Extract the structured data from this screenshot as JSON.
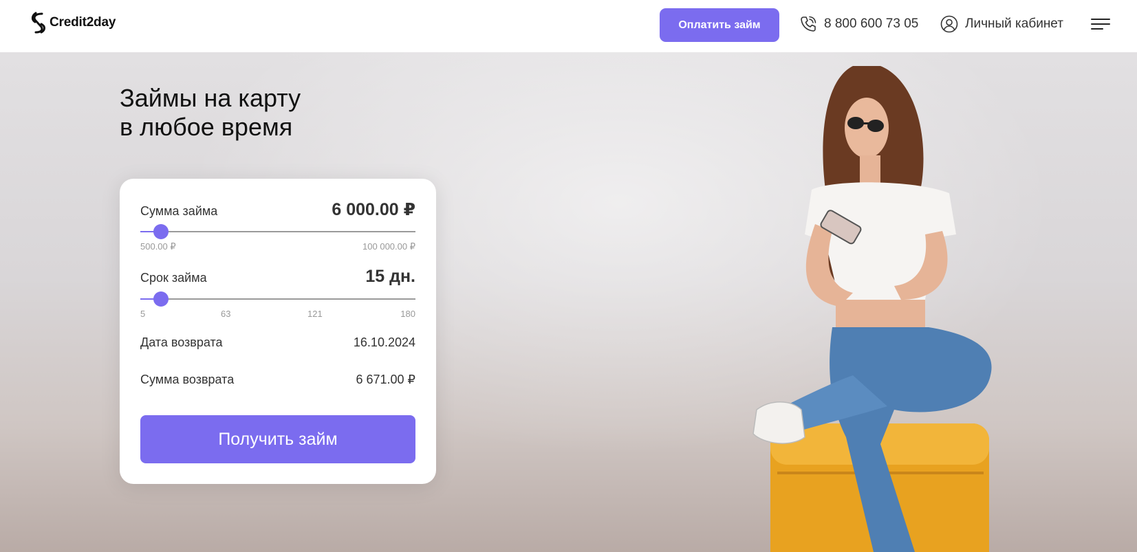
{
  "header": {
    "logo_text": "Credit2day",
    "pay_button": "Оплатить займ",
    "phone": "8 800 600 73 05",
    "cabinet": "Личный кабинет"
  },
  "hero": {
    "title_line1": "Займы на карту",
    "title_line2": "в любое время"
  },
  "calculator": {
    "amount": {
      "label": "Сумма займа",
      "value": "6 000.00 ₽",
      "min_label": "500.00 ₽",
      "max_label": "100 000.00 ₽",
      "min": 500,
      "max": 100000,
      "current": 6000
    },
    "term": {
      "label": "Срок займа",
      "value": "15 дн.",
      "ticks": [
        "5",
        "63",
        "121",
        "180"
      ],
      "min": 5,
      "max": 180,
      "current": 15
    },
    "return_date": {
      "label": "Дата возврата",
      "value": "16.10.2024"
    },
    "return_sum": {
      "label": "Сумма возврата",
      "value": "6 671.00 ₽"
    },
    "submit": "Получить займ"
  },
  "colors": {
    "accent": "#7b6cef",
    "card_bg": "#ffffff",
    "text": "#333333"
  },
  "icons": [
    "logo-icon",
    "phone-icon",
    "user-icon",
    "menu-icon"
  ]
}
